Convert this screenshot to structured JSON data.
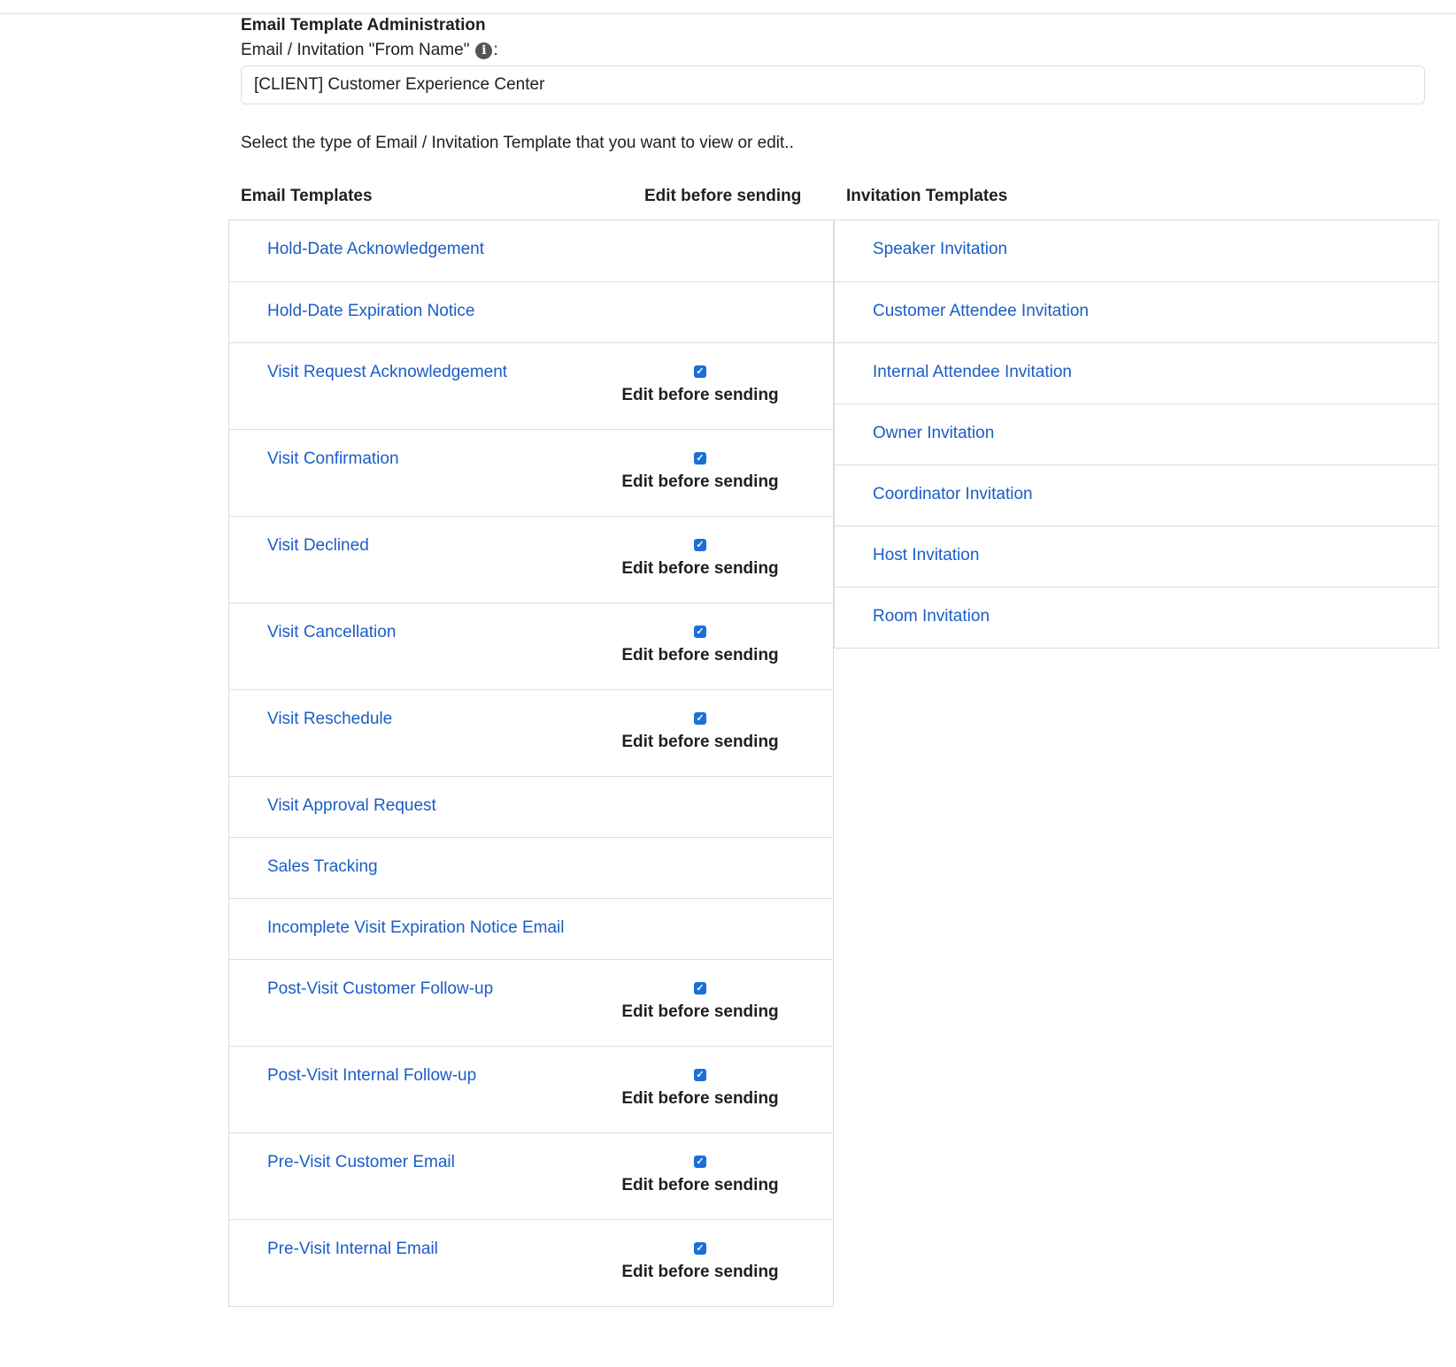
{
  "header": {
    "title": "Email Template Administration",
    "from_name_label": "Email / Invitation \"From Name\"",
    "from_name_colon": ":",
    "info_icon": "info-circle-icon"
  },
  "from_name_input": {
    "value": "[CLIENT] Customer Experience Center"
  },
  "instruction": "Select the type of Email / Invitation Template that you want to view or edit..",
  "columns": {
    "email_templates": "Email Templates",
    "edit_before_sending": "Edit before sending",
    "invitation_templates": "Invitation Templates"
  },
  "colors": {
    "link": "#1a5dc8",
    "checkbox": "#1a6fd8",
    "border": "#dcdcdc"
  },
  "email_templates": [
    {
      "label": "Hold-Date Acknowledgement",
      "has_edit": false
    },
    {
      "label": "Hold-Date Expiration Notice",
      "has_edit": false
    },
    {
      "label": "Visit Request Acknowledgement",
      "has_edit": true,
      "checked": true,
      "edit_label": "Edit before sending"
    },
    {
      "label": "Visit Confirmation",
      "has_edit": true,
      "checked": true,
      "edit_label": "Edit before sending"
    },
    {
      "label": "Visit Declined",
      "has_edit": true,
      "checked": true,
      "edit_label": "Edit before sending"
    },
    {
      "label": "Visit Cancellation",
      "has_edit": true,
      "checked": true,
      "edit_label": "Edit before sending"
    },
    {
      "label": "Visit Reschedule",
      "has_edit": true,
      "checked": true,
      "edit_label": "Edit before sending"
    },
    {
      "label": "Visit Approval Request",
      "has_edit": false
    },
    {
      "label": "Sales Tracking",
      "has_edit": false
    },
    {
      "label": "Incomplete Visit Expiration Notice Email",
      "has_edit": false
    },
    {
      "label": "Post-Visit Customer Follow-up",
      "has_edit": true,
      "checked": true,
      "edit_label": "Edit before sending"
    },
    {
      "label": "Post-Visit Internal Follow-up",
      "has_edit": true,
      "checked": true,
      "edit_label": "Edit before sending"
    },
    {
      "label": "Pre-Visit Customer Email",
      "has_edit": true,
      "checked": true,
      "edit_label": "Edit before sending"
    },
    {
      "label": "Pre-Visit Internal Email",
      "has_edit": true,
      "checked": true,
      "edit_label": "Edit before sending"
    }
  ],
  "invitation_templates": [
    {
      "label": "Speaker Invitation"
    },
    {
      "label": "Customer Attendee Invitation"
    },
    {
      "label": "Internal Attendee Invitation"
    },
    {
      "label": "Owner Invitation"
    },
    {
      "label": "Coordinator Invitation"
    },
    {
      "label": "Host Invitation"
    },
    {
      "label": "Room Invitation"
    }
  ]
}
